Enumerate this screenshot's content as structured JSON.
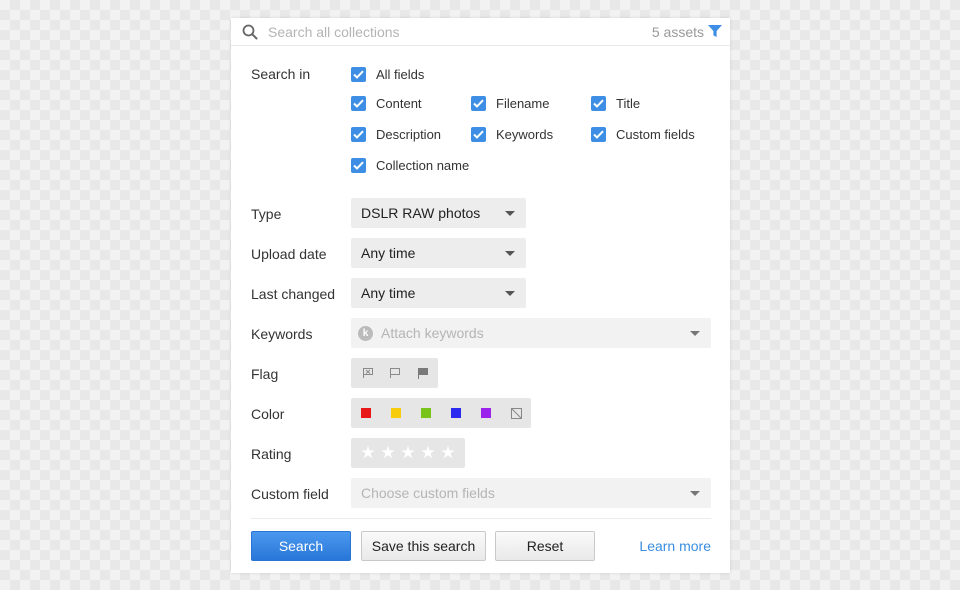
{
  "search": {
    "placeholder": "Search all collections",
    "assets_count": "5 assets"
  },
  "search_in": {
    "label": "Search in",
    "options": [
      {
        "label": "All fields",
        "checked": true
      },
      {
        "label": "Content",
        "checked": true
      },
      {
        "label": "Filename",
        "checked": true
      },
      {
        "label": "Title",
        "checked": true
      },
      {
        "label": "Description",
        "checked": true
      },
      {
        "label": "Keywords",
        "checked": true
      },
      {
        "label": "Custom fields",
        "checked": true
      },
      {
        "label": "Collection name",
        "checked": true
      }
    ]
  },
  "filters": {
    "type": {
      "label": "Type",
      "value": "DSLR RAW photos"
    },
    "upload_date": {
      "label": "Upload date",
      "value": "Any time"
    },
    "last_changed": {
      "label": "Last changed",
      "value": "Any time"
    },
    "keywords": {
      "label": "Keywords",
      "placeholder": "Attach keywords",
      "badge": "k"
    },
    "flag": {
      "label": "Flag",
      "options": [
        "reject-flag-icon",
        "unflagged-icon",
        "flagged-icon"
      ]
    },
    "color": {
      "label": "Color",
      "swatches": [
        {
          "name": "red",
          "hex": "#e8171a"
        },
        {
          "name": "yellow",
          "hex": "#f6cc0c"
        },
        {
          "name": "green",
          "hex": "#78c41a"
        },
        {
          "name": "blue",
          "hex": "#2b2bf0"
        },
        {
          "name": "purple",
          "hex": "#9b23ec"
        }
      ],
      "none_icon": "no-color-icon"
    },
    "rating": {
      "label": "Rating",
      "max_stars": 5,
      "value": 0,
      "star_glyph": "★"
    },
    "custom_field": {
      "label": "Custom field",
      "placeholder": "Choose custom fields"
    }
  },
  "actions": {
    "search": "Search",
    "save": "Save this search",
    "reset": "Reset",
    "learn_more": "Learn more"
  },
  "colors": {
    "accent": "#3d8ee4",
    "link": "#3a8ee0",
    "primary_button": "#2f7fdf"
  }
}
